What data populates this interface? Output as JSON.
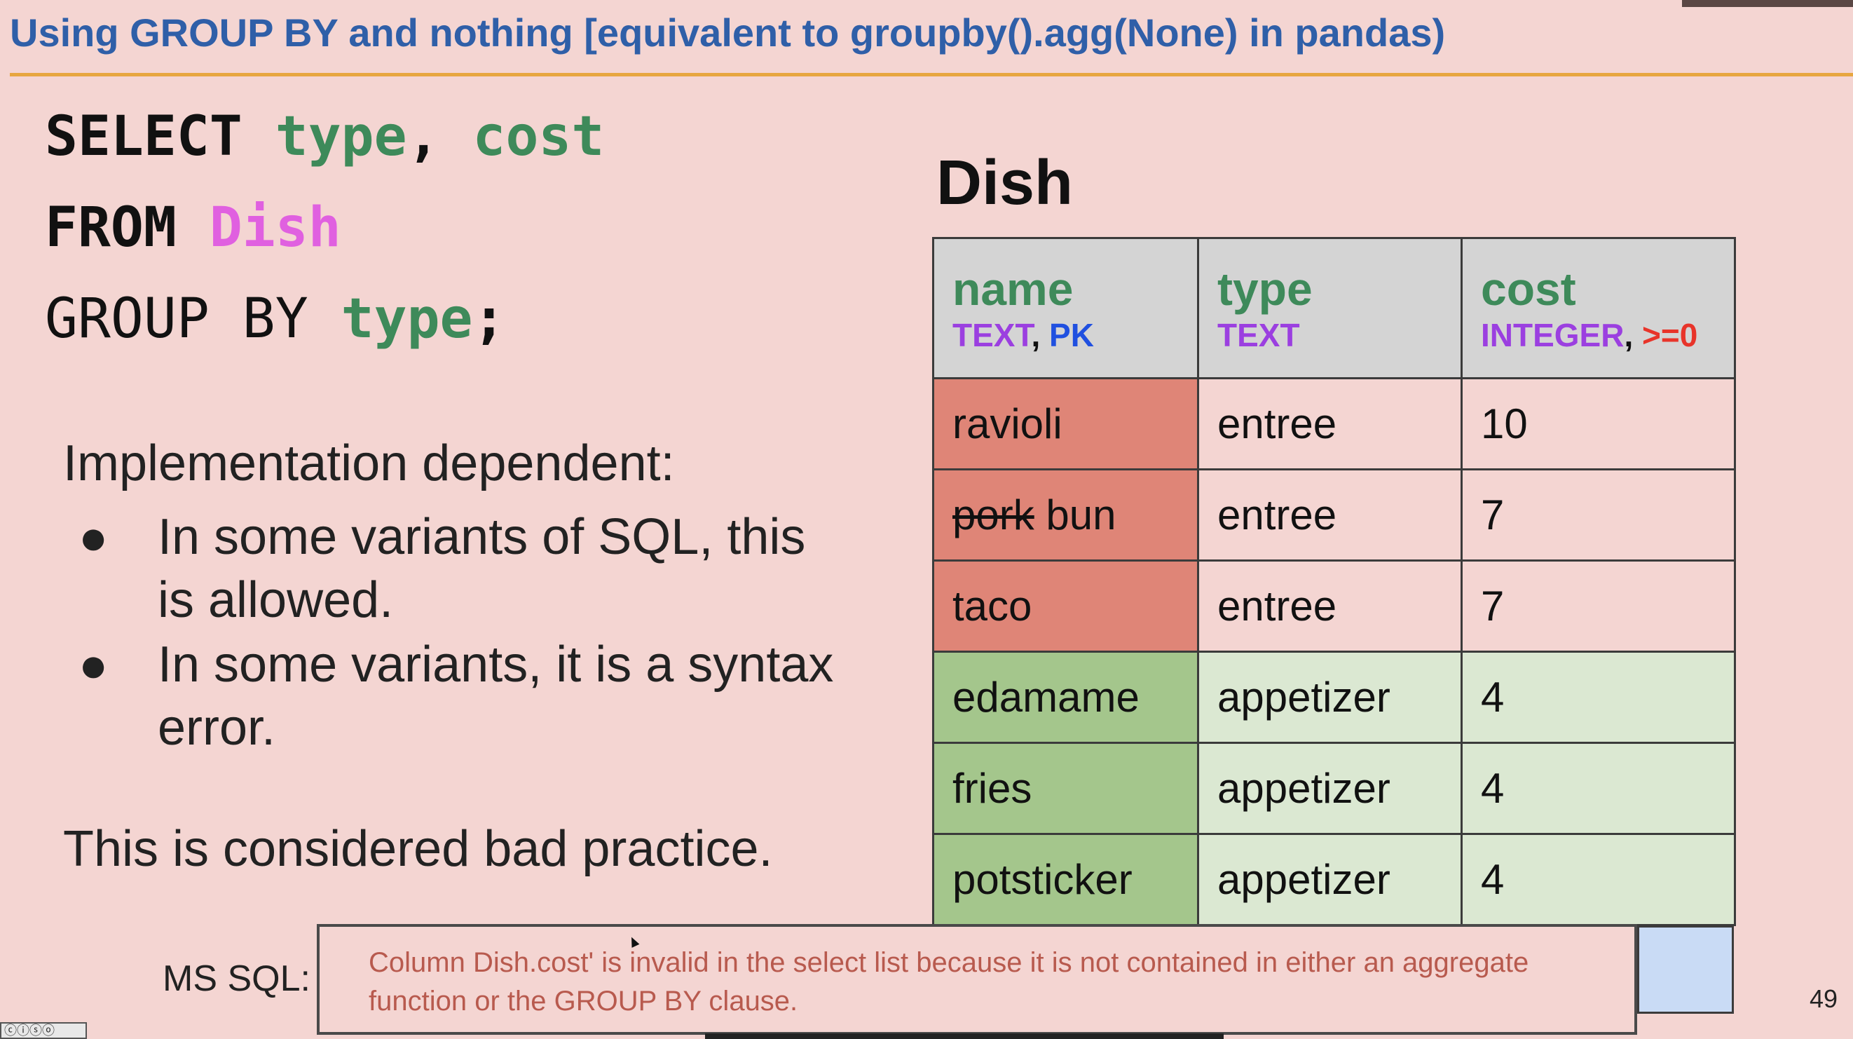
{
  "slide": {
    "title": "Using GROUP BY and nothing [equivalent to groupby().agg(None) in pandas)",
    "page_number": "49"
  },
  "code": {
    "line1": {
      "kw": "SELECT",
      "cols": [
        "type",
        "cost"
      ],
      "sep": ","
    },
    "line2": {
      "kw": "FROM",
      "table": "Dish"
    },
    "line3": {
      "kw": "GROUP BY",
      "col": "type",
      "end": ";"
    }
  },
  "explanation": {
    "lead": "Implementation dependent:",
    "bullets": [
      "In some variants of SQL, this is allowed.",
      "In some variants, it is a syntax error."
    ],
    "footer": "This is considered bad practice."
  },
  "table": {
    "title": "Dish",
    "headers": [
      {
        "name": "name",
        "type": "TEXT",
        "sep": ",",
        "constraint": "PK"
      },
      {
        "name": "type",
        "type": "TEXT"
      },
      {
        "name": "cost",
        "type": "INTEGER",
        "sep": ",",
        "constraint": ">=0"
      }
    ],
    "rows": [
      {
        "name": "ravioli",
        "type": "entree",
        "cost": "10",
        "group": "entree"
      },
      {
        "name_struck": "pork",
        "name": "bun",
        "type": "entree",
        "cost": "7",
        "group": "entree"
      },
      {
        "name": "taco",
        "type": "entree",
        "cost": "7",
        "group": "entree"
      },
      {
        "name": "edamame",
        "type": "appetizer",
        "cost": "4",
        "group": "appetizer"
      },
      {
        "name": "fries",
        "type": "appetizer",
        "cost": "4",
        "group": "appetizer"
      },
      {
        "name": "potsticker",
        "type": "appetizer",
        "cost": "4",
        "group": "appetizer"
      }
    ]
  },
  "error": {
    "label": "MS SQL:",
    "message": "Column Dish.cost' is invalid in the select list because it is not contained in either an aggregate function or the GROUP BY clause."
  },
  "colors": {
    "background": "#f4d5d2",
    "title": "#2f5fa8",
    "rule": "#e7a640",
    "column_green": "#3e8a5a",
    "table_pink": "#e060e0",
    "entree_name": "#df8577",
    "appetizer_name": "#a4c68c",
    "appetizer_cell": "#dbe8d2",
    "error_text": "#b85a4e"
  }
}
